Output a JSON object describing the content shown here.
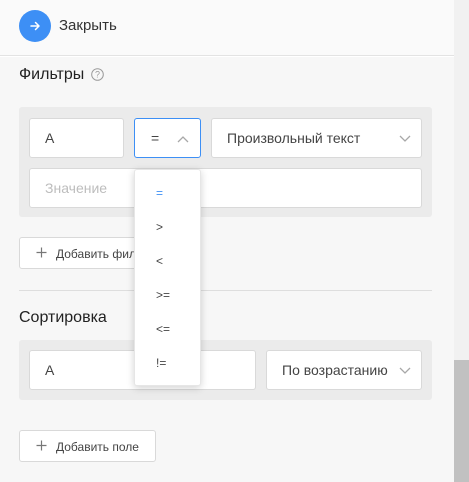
{
  "header": {
    "close_label": "Закрыть"
  },
  "filters": {
    "title": "Фильтры",
    "field_value": "A",
    "operator_value": "=",
    "type_value": "Произвольный текст",
    "value_placeholder": "Значение",
    "add_button_label": "Добавить фил"
  },
  "operator_options": [
    "=",
    ">",
    "<",
    ">=",
    "<=",
    "!="
  ],
  "sorting": {
    "title": "Сортировка",
    "field_value": "A",
    "order_value": "По возрастанию",
    "add_button_label": "Добавить поле"
  },
  "icons": {
    "close": "arrow-right-icon",
    "help": "question-circle-icon",
    "chevron_up": "chevron-up-icon",
    "chevron_down": "chevron-down-icon",
    "plus": "plus-icon"
  },
  "colors": {
    "accent": "#3d8ff5",
    "panel": "#ebebeb"
  }
}
